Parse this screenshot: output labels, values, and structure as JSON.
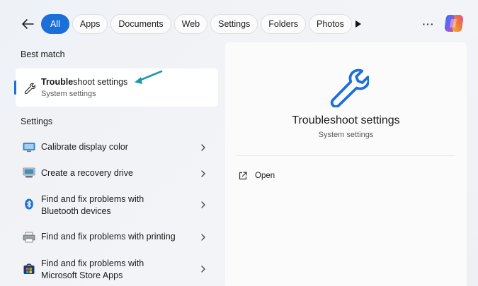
{
  "filters": [
    {
      "label": "All",
      "active": true
    },
    {
      "label": "Apps"
    },
    {
      "label": "Documents"
    },
    {
      "label": "Web"
    },
    {
      "label": "Settings"
    },
    {
      "label": "Folders"
    },
    {
      "label": "Photos"
    }
  ],
  "more_label": "···",
  "best_match": {
    "heading": "Best match",
    "title_bold": "Trouble",
    "title_rest": "shoot settings",
    "subtitle": "System settings",
    "icon": "wrench-icon"
  },
  "settings": {
    "heading": "Settings",
    "items": [
      {
        "label": "Calibrate display color",
        "icon": "display-icon"
      },
      {
        "label": "Create a recovery drive",
        "icon": "recovery-drive-icon"
      },
      {
        "label": "Find and fix problems with\nBluetooth devices",
        "line1": "Find and fix problems with",
        "line2": "Bluetooth devices",
        "icon": "bluetooth-icon"
      },
      {
        "label": "Find and fix problems with printing",
        "icon": "printer-icon"
      },
      {
        "label": "Find and fix problems with\nMicrosoft Store Apps",
        "line1": "Find and fix problems with",
        "line2": "Microsoft Store Apps",
        "icon": "store-icon"
      }
    ]
  },
  "preview": {
    "title": "Troubleshoot settings",
    "subtitle": "System settings",
    "action_label": "Open"
  },
  "colors": {
    "accent": "#1a6fd9",
    "annotation_arrow": "#1a9aa8"
  }
}
